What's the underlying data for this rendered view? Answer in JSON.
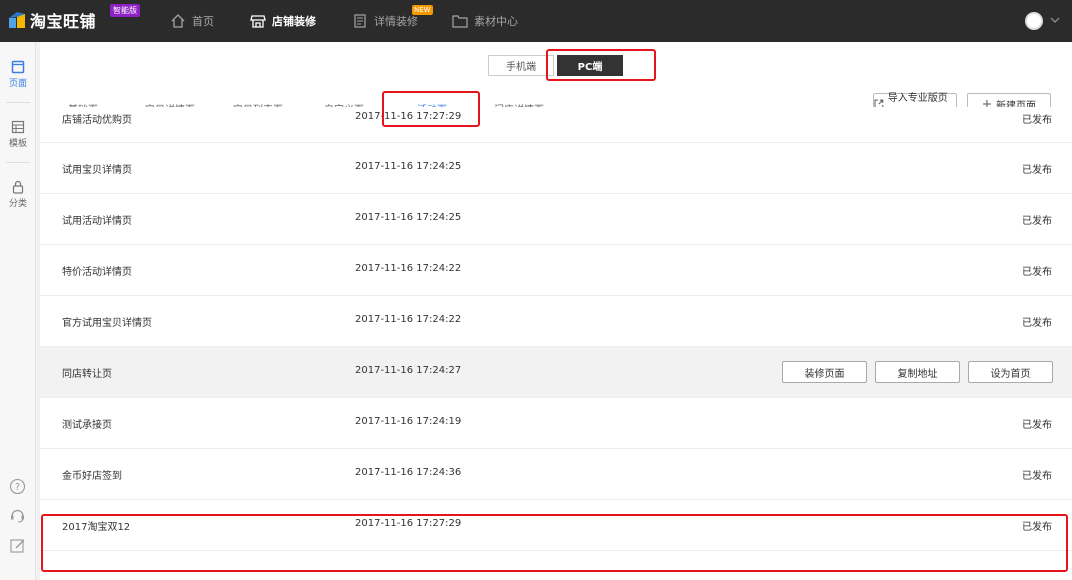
{
  "brand": {
    "name": "淘宝旺铺",
    "badge": "智能版"
  },
  "nav": [
    {
      "label": "首页",
      "icon": "home-icon"
    },
    {
      "label": "店铺装修",
      "icon": "store-icon"
    },
    {
      "label": "详情装修",
      "icon": "detail-page-icon",
      "badge": "NEW"
    },
    {
      "label": "素材中心",
      "icon": "folder-icon"
    }
  ],
  "sidebar": {
    "items": [
      {
        "label": "页面",
        "icon": "page-icon"
      },
      {
        "label": "模板",
        "icon": "template-icon"
      },
      {
        "label": "分类",
        "icon": "lock-icon"
      }
    ],
    "tools": [
      "help-icon",
      "customer-service-icon",
      "edit-icon"
    ]
  },
  "device": {
    "mobile": "手机端",
    "pc": "PC端"
  },
  "tabs": [
    "基础页",
    "宝贝详情页",
    "宝贝列表页",
    "自定义页",
    "活动页",
    "门店详情页"
  ],
  "actions": {
    "import": "导入专业版页面",
    "new_page": "新建页面"
  },
  "rows": [
    {
      "name": "店铺活动优购页",
      "time": "2017-11-16 17:27:29",
      "status": "已发布"
    },
    {
      "name": "试用宝贝详情页",
      "time": "2017-11-16 17:24:25",
      "status": "已发布"
    },
    {
      "name": "试用活动详情页",
      "time": "2017-11-16 17:24:25",
      "status": "已发布"
    },
    {
      "name": "特价活动详情页",
      "time": "2017-11-16 17:24:22",
      "status": "已发布"
    },
    {
      "name": "官方试用宝贝详情页",
      "time": "2017-11-16 17:24:22",
      "status": "已发布"
    },
    {
      "name": "同店转让页",
      "time": "2017-11-16 17:24:27",
      "buttons": [
        "装修页面",
        "复制地址",
        "设为首页"
      ]
    },
    {
      "name": "测试承接页",
      "time": "2017-11-16 17:24:19",
      "status": "已发布"
    },
    {
      "name": "金币好店签到",
      "time": "2017-11-16 17:24:36",
      "status": "已发布"
    },
    {
      "name": "2017淘宝双12",
      "time": "2017-11-16 17:27:29",
      "status": "已发布"
    }
  ],
  "colors": {
    "accent": "#3a7ee3",
    "highlight": "#e8141b",
    "topbar": "#2b2b2b",
    "badge": "#8e22c4",
    "new_badge": "#f39800"
  }
}
